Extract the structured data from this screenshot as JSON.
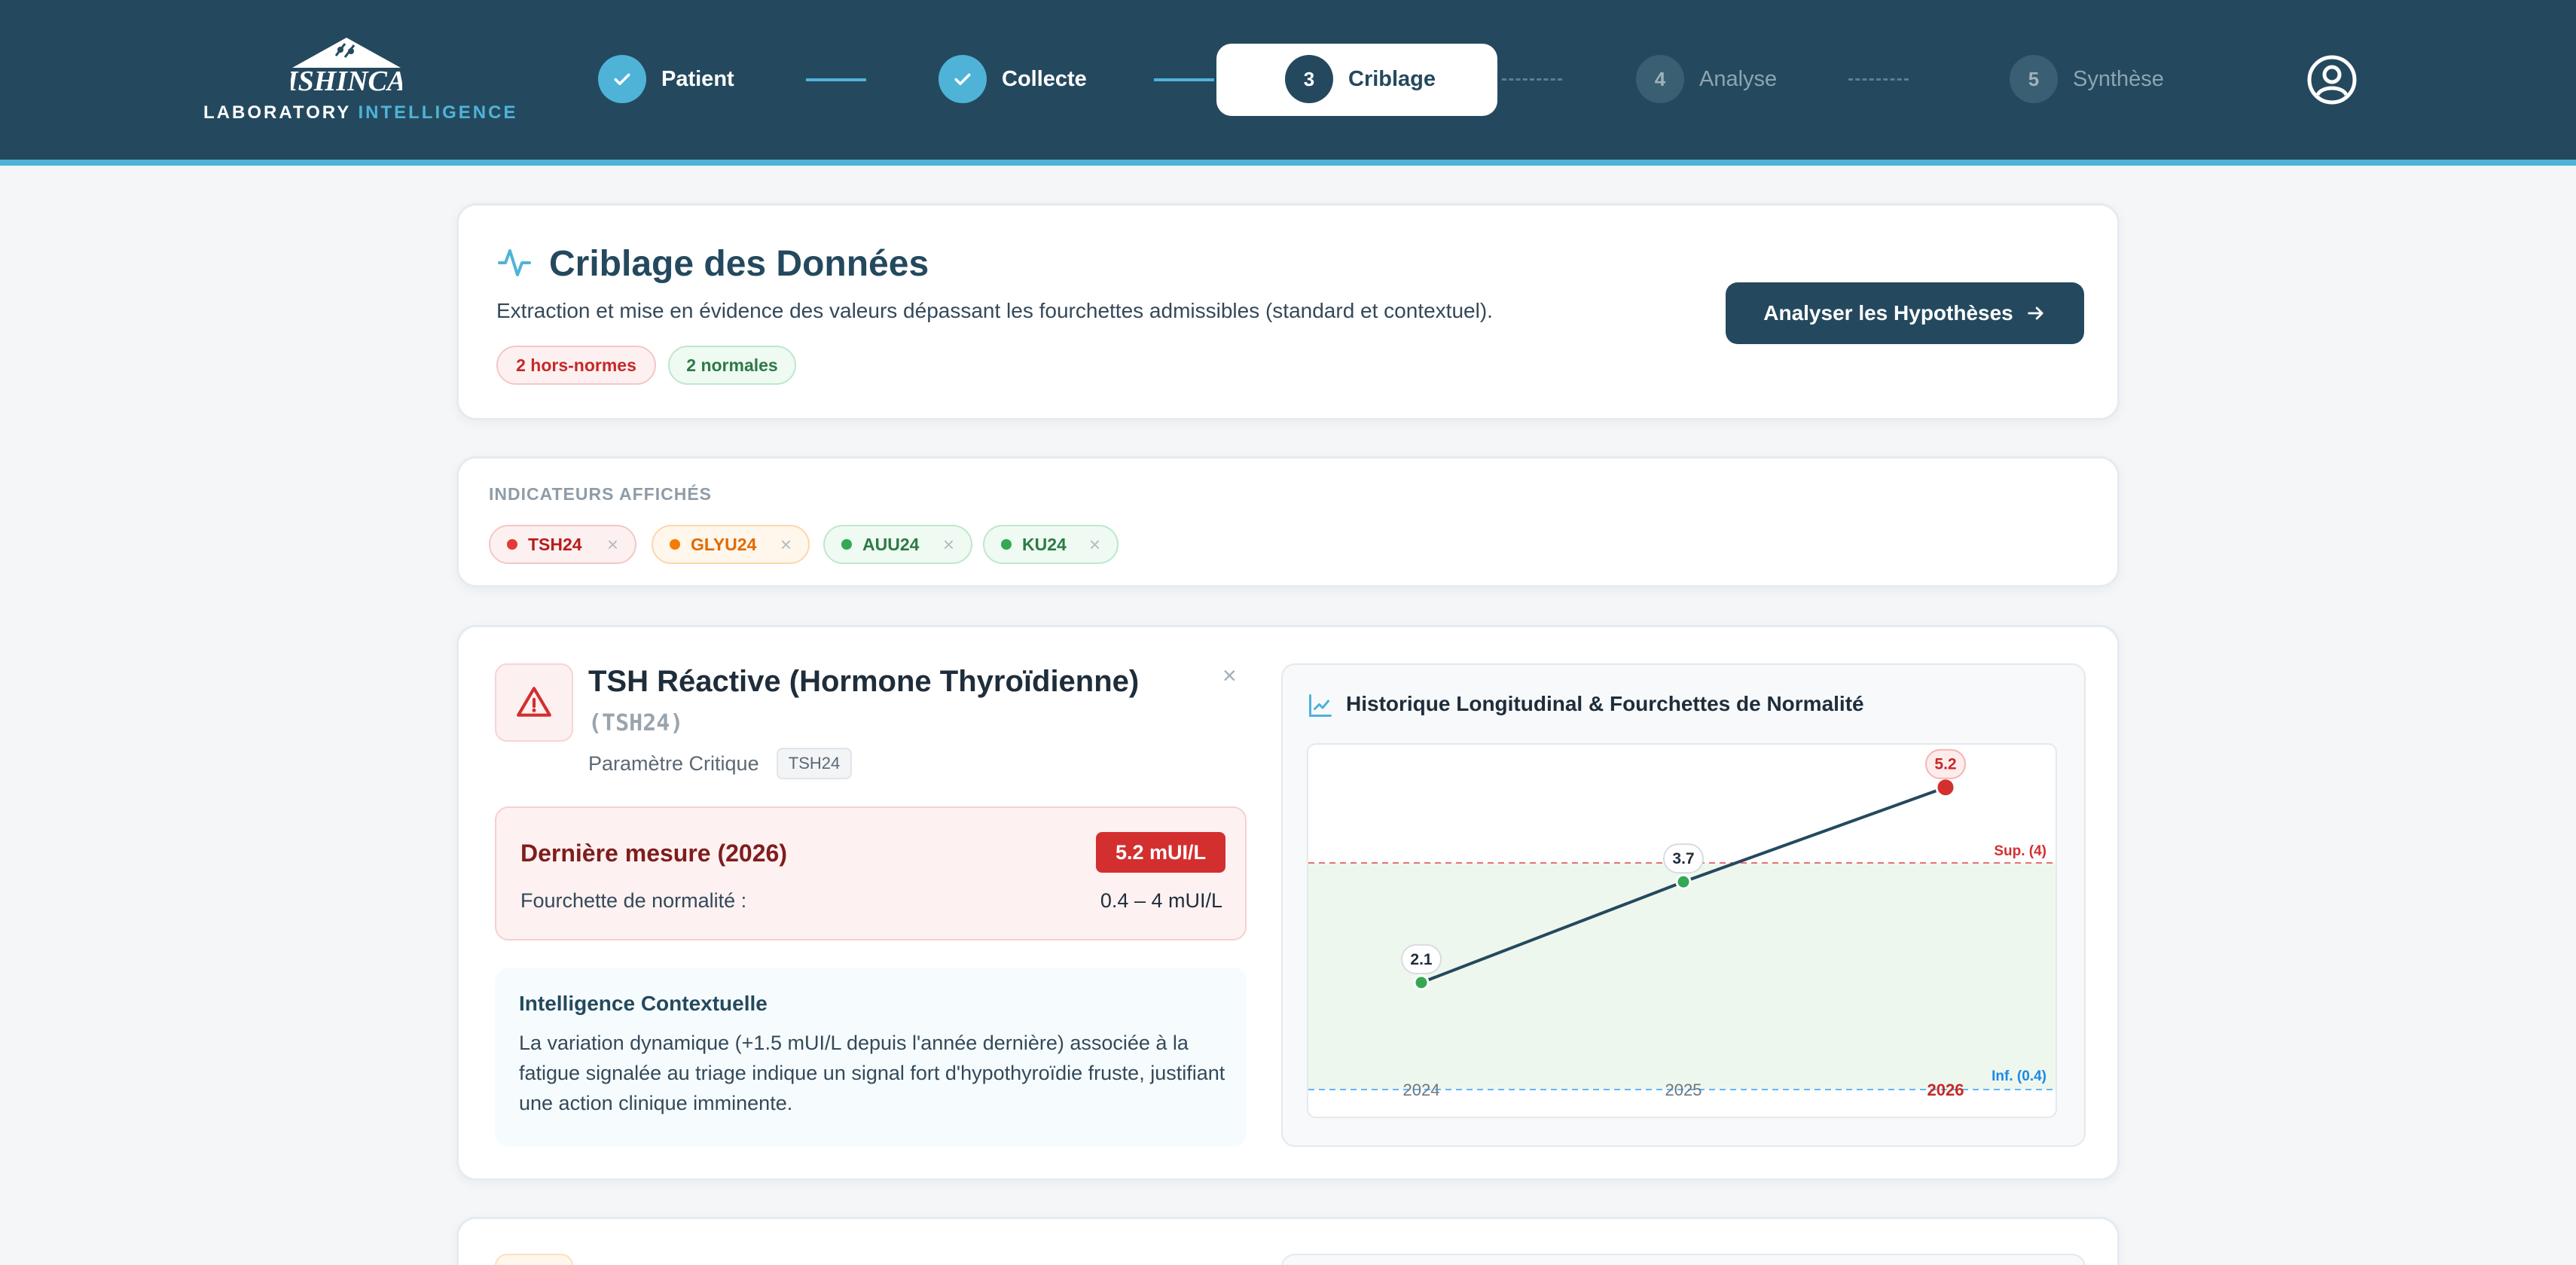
{
  "brand": {
    "logo_text": "ISHINCA",
    "sub_part1": "LABORATORY",
    "sub_part2": "INTELLIGENCE"
  },
  "stepper": {
    "steps": [
      {
        "label": "Patient",
        "state": "done"
      },
      {
        "label": "Collecte",
        "state": "done"
      },
      {
        "number": "3",
        "label": "Criblage",
        "state": "current"
      },
      {
        "number": "4",
        "label": "Analyse",
        "state": "todo"
      },
      {
        "number": "5",
        "label": "Synthèse",
        "state": "todo"
      }
    ]
  },
  "header_card": {
    "title": "Criblage des Données",
    "description": "Extraction et mise en évidence des valeurs dépassant les fourchettes admissibles (standard et contextuel).",
    "badge_abnormal": "2 hors-normes",
    "badge_normal": "2 normales",
    "action_label": "Analyser les Hypothèses"
  },
  "indicators": {
    "label": "INDICATEURS AFFICHÉS",
    "chips": [
      {
        "label": "TSH24",
        "color": "#e53935"
      },
      {
        "label": "GLYU24",
        "color": "#f57c00"
      },
      {
        "label": "AUU24",
        "color": "#34a853"
      },
      {
        "label": "KU24",
        "color": "#34a853"
      }
    ],
    "remove_glyph": "×"
  },
  "tsh_card": {
    "title": "TSH Réactive (Hormone Thyroïdienne)",
    "code": "(TSH24)",
    "subtitle": "Paramètre Critique",
    "tag": "TSH24",
    "close_glyph": "×",
    "last_measure_label": "Dernière mesure (2026)",
    "last_measure_value": "5.2 mUI/L",
    "range_label": "Fourchette de normalité :",
    "range_value": "0.4 – 4 mUI/L",
    "context_title": "Intelligence Contextuelle",
    "context_text": "La variation dynamique (+1.5 mUI/L depuis l'année dernière) associée à la fatigue signalée au triage indique un signal fort d'hypothyroïdie fruste, justifiant une action clinique imminente."
  },
  "chart_data": {
    "type": "line",
    "title": "Historique Longitudinal & Fourchettes de Normalité",
    "x": [
      "2024",
      "2025",
      "2026"
    ],
    "series": [
      {
        "values": [
          2.1,
          3.7,
          5.2
        ]
      }
    ],
    "upper_limit": 4,
    "lower_limit": 0.4,
    "upper_label": "Sup. (4)",
    "lower_label": "Inf. (0.4)",
    "ylim": [
      0.4,
      5.4
    ],
    "grid": false,
    "normal_band_color": "#eef7ee",
    "line_color": "#24495e",
    "normal_point_color": "#34a853",
    "abnormal_point_color": "#d32f2f",
    "upper_color": "#e57373",
    "lower_color": "#64b5f6"
  },
  "icons": {
    "step_done": "check-icon",
    "title": "activity-icon",
    "action": "arrow-right-icon",
    "warning": "alert-triangle-icon",
    "chart": "line-chart-icon",
    "user": "user-circle-icon"
  }
}
